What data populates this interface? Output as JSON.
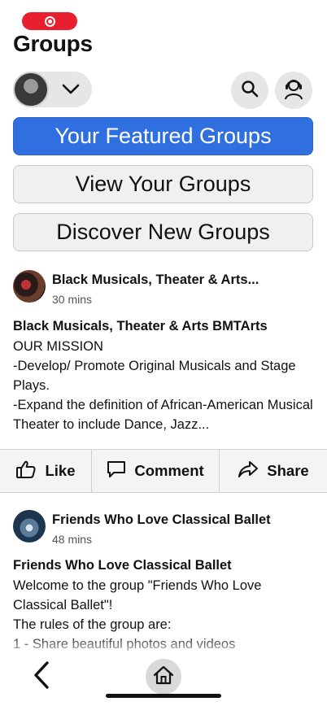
{
  "header": {
    "title": "Groups"
  },
  "tabs": [
    {
      "label": "Your Featured Groups",
      "active": true
    },
    {
      "label": "View Your Groups",
      "active": false
    },
    {
      "label": "Discover New Groups",
      "active": false
    }
  ],
  "posts": [
    {
      "group_name": "Black Musicals, Theater & Arts...",
      "time": "30 mins",
      "title": "Black Musicals, Theater & Arts BMTArts",
      "body": "OUR MISSION\n-Develop/ Promote Original Musicals and Stage Plays.\n-Expand the definition of African-American Musical Theater to include Dance, Jazz..."
    },
    {
      "group_name": "Friends Who Love Classical Ballet",
      "time": "48 mins",
      "title": "Friends Who Love Classical Ballet",
      "body": "Welcome to the group \"Friends Who Love Classical Ballet\"!\nThe rules of the group are:\n1 - Share beautiful photos and videos"
    }
  ],
  "actions": {
    "like": "Like",
    "comment": "Comment",
    "share": "Share"
  },
  "icons": {
    "record": "record-icon",
    "search": "search-icon",
    "profile": "person-headset-icon",
    "chevron": "chevron-down-icon",
    "like": "thumbs-up-icon",
    "comment": "comment-icon",
    "share": "share-icon",
    "back": "back-arrow-icon",
    "home": "home-icon"
  },
  "colors": {
    "accent": "#2f6fe0",
    "record": "#e8202e"
  }
}
